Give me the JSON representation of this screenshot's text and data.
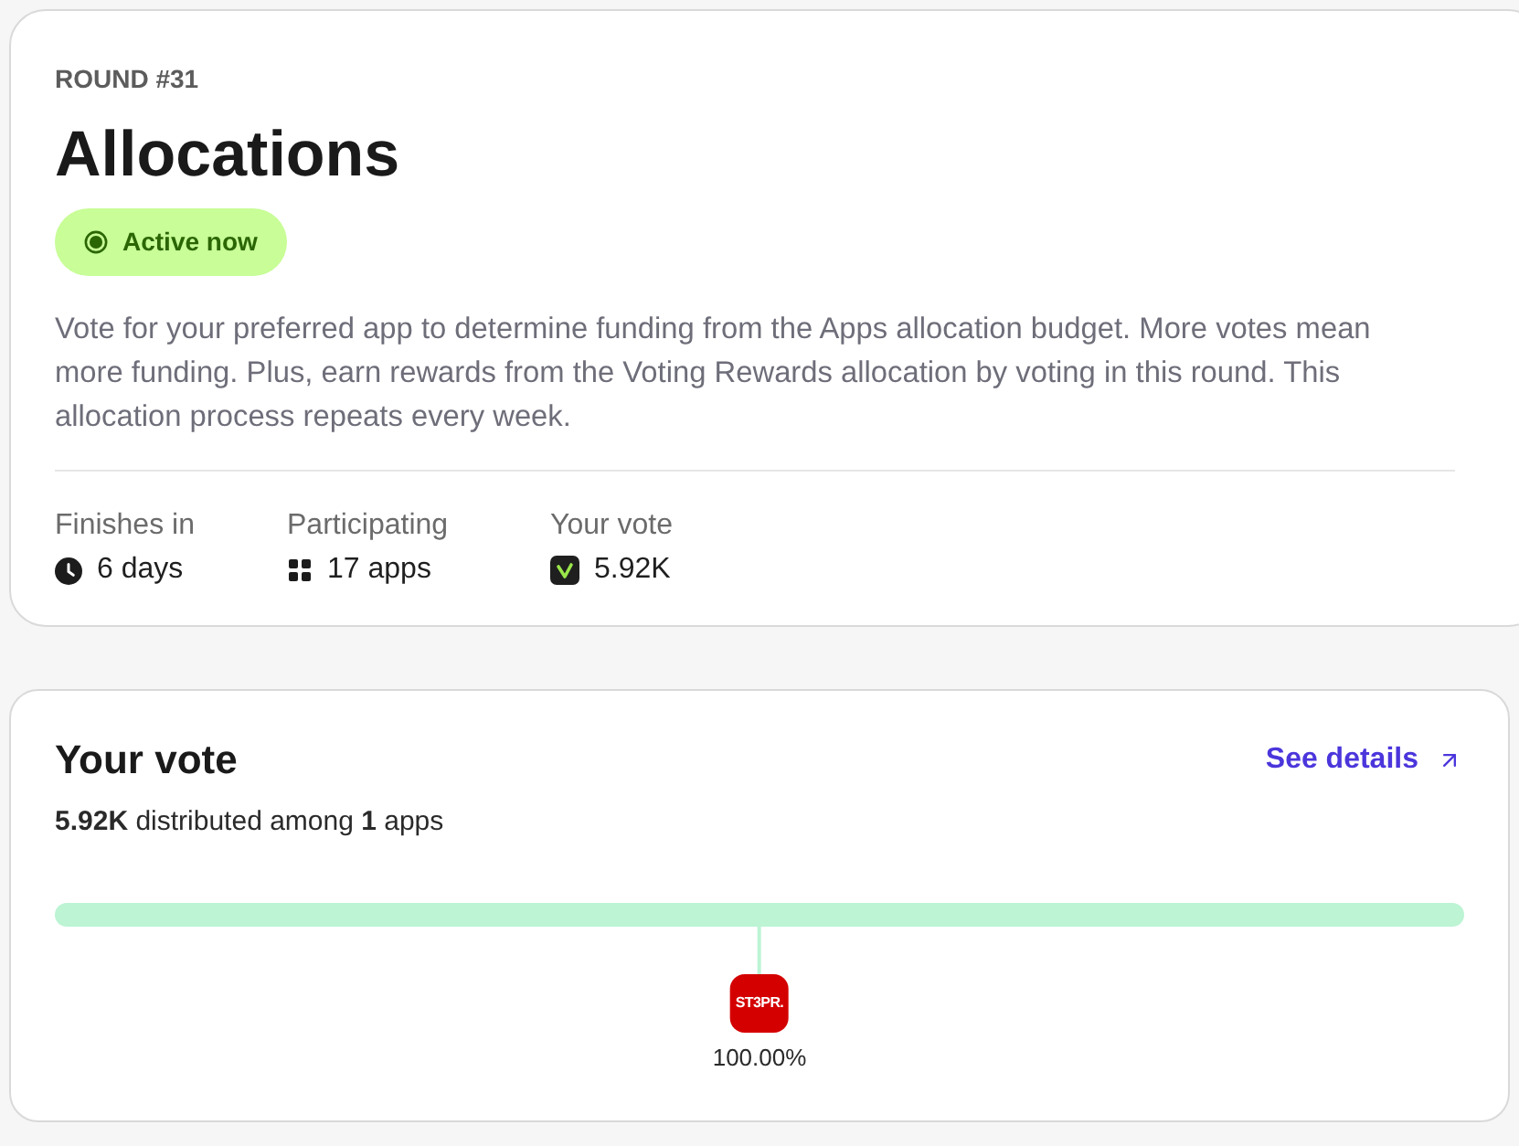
{
  "round": {
    "label": "ROUND #31",
    "title": "Allocations",
    "status": {
      "label": "Active now",
      "active": true
    },
    "description": "Vote for your preferred app to determine funding from the Apps allocation budget. More votes mean more funding. Plus, earn rewards from the Voting Rewards allocation by voting in this round. This allocation process repeats every week.",
    "stats": [
      {
        "kind": "time",
        "label": "Finishes in",
        "value": "6 days"
      },
      {
        "kind": "apps",
        "label": "Participating",
        "value": "17 apps"
      },
      {
        "kind": "vote",
        "label": "Your vote",
        "value": "5.92K"
      }
    ]
  },
  "your_vote": {
    "title": "Your vote",
    "link": "See details",
    "summary": "**5.92K** distributed among **1** apps",
    "apps": [
      {
        "logo_text": "ST3PR.",
        "color": "#d40000",
        "level": 1,
        "share": "100.00%"
      }
    ]
  }
}
